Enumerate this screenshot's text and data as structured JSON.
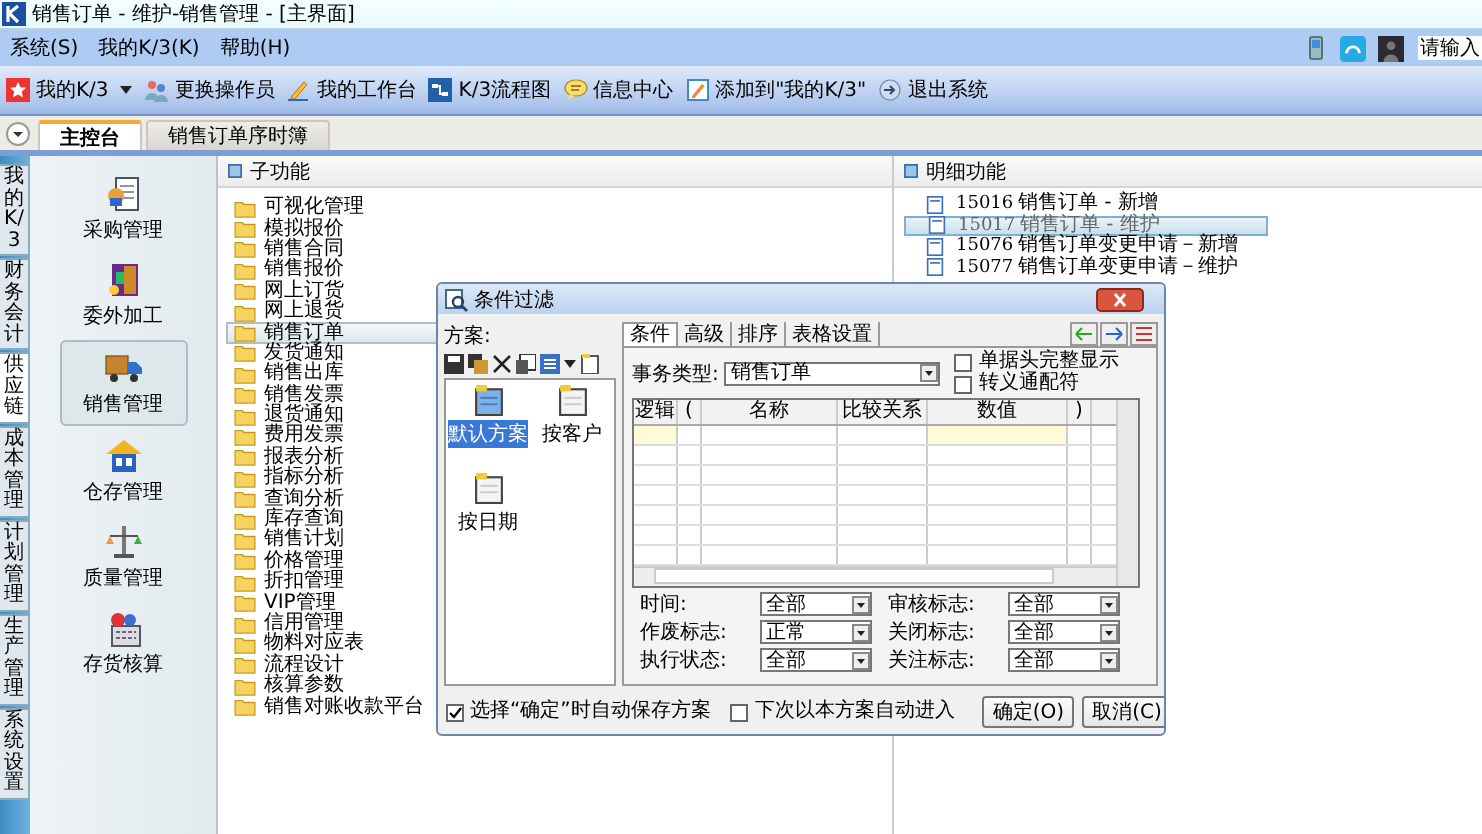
{
  "window": {
    "title": "销售订单 - 维护-销售管理 - [主界面]"
  },
  "menu": [
    "系统(S)",
    "我的K/3(K)",
    "帮助(H)"
  ],
  "search": {
    "placeholder": "请输入"
  },
  "toolbar": [
    {
      "label": "我的K/3",
      "dropdown": true
    },
    {
      "label": "更换操作员",
      "dropdown": false
    },
    {
      "label": "我的工作台",
      "dropdown": false
    },
    {
      "label": "K/3流程图",
      "dropdown": false
    },
    {
      "label": "信息中心",
      "dropdown": false
    },
    {
      "label": "添加到\"我的K/3\"",
      "dropdown": false
    },
    {
      "label": "退出系统",
      "dropdown": false
    }
  ],
  "tabs": [
    {
      "label": "主控台",
      "selected": true
    },
    {
      "label": "销售订单序时簿",
      "selected": false
    }
  ],
  "side_tabs": [
    {
      "label": "我的K/3",
      "selected": false
    },
    {
      "label": "财务会计",
      "selected": false
    },
    {
      "label": "供应链",
      "selected": true
    },
    {
      "label": "成本管理",
      "selected": false
    },
    {
      "label": "计划管理",
      "selected": false
    },
    {
      "label": "生产管理",
      "selected": false
    },
    {
      "label": "系统设置",
      "selected": false
    }
  ],
  "modules": [
    {
      "label": "采购管理",
      "selected": false
    },
    {
      "label": "委外加工",
      "selected": false
    },
    {
      "label": "销售管理",
      "selected": true
    },
    {
      "label": "仓存管理",
      "selected": false
    },
    {
      "label": "质量管理",
      "selected": false
    },
    {
      "label": "存货核算",
      "selected": false
    }
  ],
  "sub_functions": {
    "title": "子功能",
    "items": [
      {
        "label": "可视化管理",
        "selected": false
      },
      {
        "label": "模拟报价",
        "selected": false
      },
      {
        "label": "销售合同",
        "selected": false
      },
      {
        "label": "销售报价",
        "selected": false
      },
      {
        "label": "网上订货",
        "selected": false
      },
      {
        "label": "网上退货",
        "selected": false
      },
      {
        "label": "销售订单",
        "selected": true
      },
      {
        "label": "发货通知",
        "selected": false
      },
      {
        "label": "销售出库",
        "selected": false
      },
      {
        "label": "销售发票",
        "selected": false
      },
      {
        "label": "退货通知",
        "selected": false
      },
      {
        "label": "费用发票",
        "selected": false
      },
      {
        "label": "报表分析",
        "selected": false
      },
      {
        "label": "指标分析",
        "selected": false
      },
      {
        "label": "查询分析",
        "selected": false
      },
      {
        "label": "库存查询",
        "selected": false
      },
      {
        "label": "销售计划",
        "selected": false
      },
      {
        "label": "价格管理",
        "selected": false
      },
      {
        "label": "折扣管理",
        "selected": false
      },
      {
        "label": "VIP管理",
        "selected": false
      },
      {
        "label": "信用管理",
        "selected": false
      },
      {
        "label": "物料对应表",
        "selected": false
      },
      {
        "label": "流程设计",
        "selected": false
      },
      {
        "label": "核算参数",
        "selected": false
      },
      {
        "label": "销售对账收款平台",
        "selected": false
      }
    ]
  },
  "details": {
    "title": "明细功能",
    "items": [
      {
        "code": "15016",
        "label": "销售订单 - 新增",
        "selected": false
      },
      {
        "code": "15017",
        "label": "销售订单 - 维护",
        "selected": true
      },
      {
        "code": "15076",
        "label": "销售订单变更申请－新增",
        "selected": false
      },
      {
        "code": "15077",
        "label": "销售订单变更申请－维护",
        "selected": false
      }
    ]
  },
  "dialog": {
    "title": "条件过滤",
    "scheme_label": "方案:",
    "schemes": [
      {
        "label": "默认方案",
        "selected": true
      },
      {
        "label": "按客户",
        "selected": false
      },
      {
        "label": "按日期",
        "selected": false
      }
    ],
    "tabs": [
      {
        "label": "条件",
        "selected": true
      },
      {
        "label": "高级",
        "selected": false
      },
      {
        "label": "排序",
        "selected": false
      },
      {
        "label": "表格设置",
        "selected": false
      }
    ],
    "type_label": "事务类型:",
    "type_value": "销售订单",
    "options": [
      {
        "label": "单据头完整显示",
        "checked": false
      },
      {
        "label": "转义通配符",
        "checked": false
      }
    ],
    "columns": [
      "逻辑",
      "(",
      "名称",
      "比较关系",
      "数值",
      ")"
    ],
    "filters": [
      {
        "label": "时间:",
        "value": "全部"
      },
      {
        "label": "审核标志:",
        "value": "全部"
      },
      {
        "label": "作废标志:",
        "value": "正常"
      },
      {
        "label": "关闭标志:",
        "value": "全部"
      },
      {
        "label": "执行状态:",
        "value": "全部"
      },
      {
        "label": "关注标志:",
        "value": "全部"
      }
    ],
    "footer_options": [
      {
        "label": "选择“确定”时自动保存方案",
        "checked": true
      },
      {
        "label": "下次以本方案自动进入",
        "checked": false
      }
    ],
    "buttons": [
      "确定(O)",
      "取消(C)"
    ]
  }
}
